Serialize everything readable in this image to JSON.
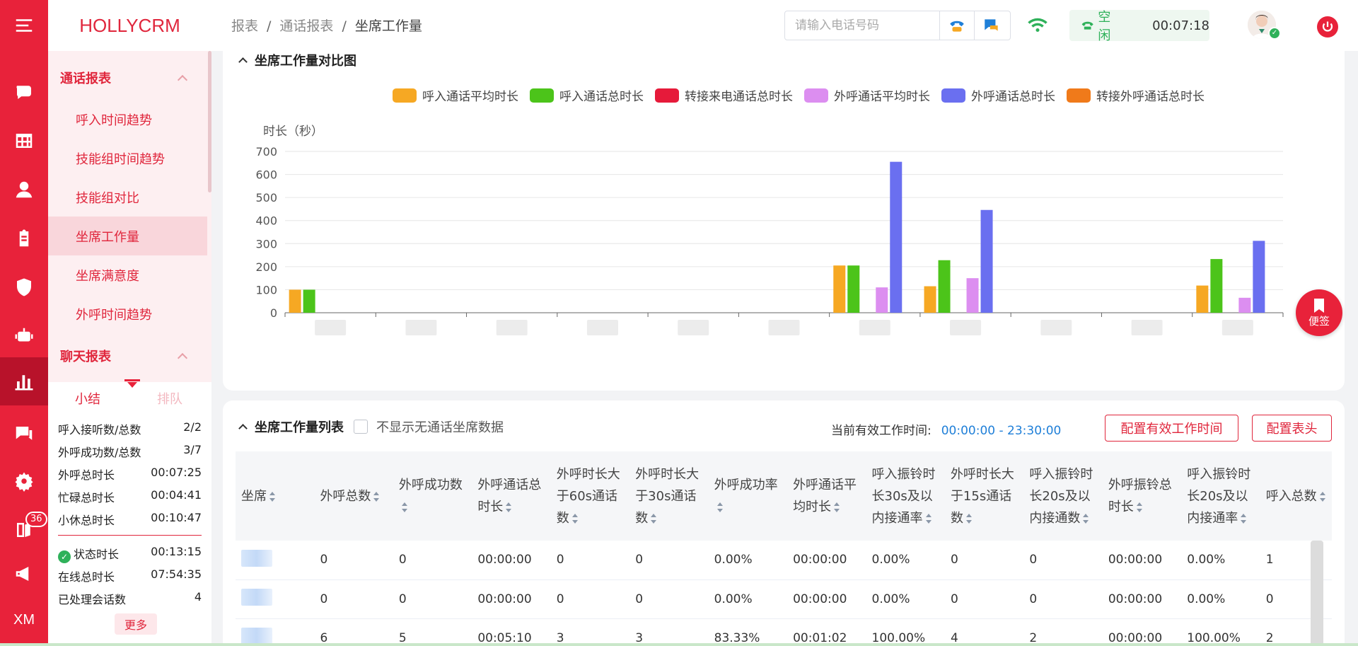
{
  "brand": "HOLLYCRM",
  "rail": {
    "badge_count": "36",
    "footer_text": "XM",
    "icons": [
      "menu-icon",
      "chat-icon",
      "grid-icon",
      "user-icon",
      "clipboard-icon",
      "shield-icon",
      "robot-icon",
      "bar-chart-icon",
      "message-icon",
      "settings-icon",
      "book-icon",
      "megaphone-icon"
    ]
  },
  "sidebar": {
    "section1": "通话报表",
    "items": [
      "呼入时间趋势",
      "技能组时间趋势",
      "技能组对比",
      "坐席工作量",
      "坐席满意度",
      "外呼时间趋势"
    ],
    "active_index": 3,
    "section2": "聊天报表",
    "tabs": [
      "小结",
      "排队"
    ],
    "stats": [
      {
        "label": "呼入接听数/总数",
        "value": "2/2"
      },
      {
        "label": "外呼成功数/总数",
        "value": "3/7"
      },
      {
        "label": "外呼总时长",
        "value": "00:07:25"
      },
      {
        "label": "忙碌总时长",
        "value": "00:04:41"
      },
      {
        "label": "小休总时长",
        "value": "00:10:47"
      },
      {
        "label": "状态时长",
        "value": "00:13:15"
      },
      {
        "label": "在线总时长",
        "value": "07:54:35"
      },
      {
        "label": "已处理会话数",
        "value": "4"
      }
    ],
    "more": "更多"
  },
  "header": {
    "breadcrumb": [
      "报表",
      "通话报表",
      "坐席工作量"
    ],
    "search_placeholder": "请输入电话号码",
    "status_label": "空闲",
    "status_time": "00:07:18"
  },
  "chart_card": {
    "title": "坐席工作量对比图"
  },
  "chart_data": {
    "type": "bar",
    "ylabel": "时长（秒）",
    "ylim": [
      0,
      700
    ],
    "yticks": [
      0,
      100,
      200,
      300,
      400,
      500,
      600,
      700
    ],
    "grid": true,
    "legend_position": "top-center",
    "categories": [
      "",
      "",
      "",
      "",
      "",
      "",
      "",
      "",
      "",
      "",
      ""
    ],
    "series": [
      {
        "name": "呼入通话平均时长",
        "color": "#f6a823",
        "values": [
          100,
          0,
          0,
          0,
          0,
          0,
          205,
          115,
          0,
          0,
          118
        ]
      },
      {
        "name": "呼入通话总时长",
        "color": "#4cc41a",
        "values": [
          100,
          0,
          0,
          0,
          0,
          0,
          205,
          228,
          0,
          0,
          233
        ]
      },
      {
        "name": "转接来电通话总时长",
        "color": "#e61a3a",
        "values": [
          0,
          0,
          0,
          0,
          0,
          0,
          0,
          0,
          0,
          0,
          0
        ]
      },
      {
        "name": "外呼通话平均时长",
        "color": "#dc8ef0",
        "values": [
          0,
          0,
          0,
          0,
          0,
          0,
          110,
          150,
          0,
          0,
          65
        ]
      },
      {
        "name": "外呼通话总时长",
        "color": "#6a6ff0",
        "values": [
          0,
          0,
          0,
          0,
          0,
          0,
          655,
          446,
          0,
          0,
          312
        ]
      },
      {
        "name": "转接外呼通话总时长",
        "color": "#f07a1a",
        "values": [
          0,
          0,
          0,
          0,
          0,
          0,
          0,
          0,
          0,
          0,
          0
        ]
      }
    ]
  },
  "list_card": {
    "title": "坐席工作量列表",
    "checkbox_label": "不显示无通话坐席数据",
    "work_time_label": "当前有效工作时间:",
    "work_time_value": "00:00:00 - 23:30:00",
    "btn_config_time": "配置有效工作时间",
    "btn_config_header": "配置表头",
    "columns": [
      "坐席",
      "外呼总数",
      "外呼成功数",
      "外呼通话总时长",
      "外呼时长大于60s通话数",
      "外呼时长大于30s通话数",
      "外呼成功率",
      "外呼通话平均时长",
      "呼入振铃时长30s及以内接通率",
      "外呼时长大于15s通话数",
      "呼入振铃时长20s及以内接通数",
      "外呼振铃总时长",
      "呼入振铃时长20s及以内接通率",
      "呼入总数"
    ],
    "rows": [
      [
        "",
        "0",
        "0",
        "00:00:00",
        "0",
        "0",
        "0.00%",
        "00:00:00",
        "0.00%",
        "0",
        "0",
        "00:00:00",
        "0.00%",
        "1"
      ],
      [
        "",
        "0",
        "0",
        "00:00:00",
        "0",
        "0",
        "0.00%",
        "00:00:00",
        "0.00%",
        "0",
        "0",
        "00:00:00",
        "0.00%",
        "0"
      ],
      [
        "",
        "6",
        "5",
        "00:05:10",
        "3",
        "3",
        "83.33%",
        "00:01:02",
        "100.00%",
        "4",
        "2",
        "00:00:00",
        "100.00%",
        "2"
      ]
    ]
  },
  "note_button": "便签"
}
